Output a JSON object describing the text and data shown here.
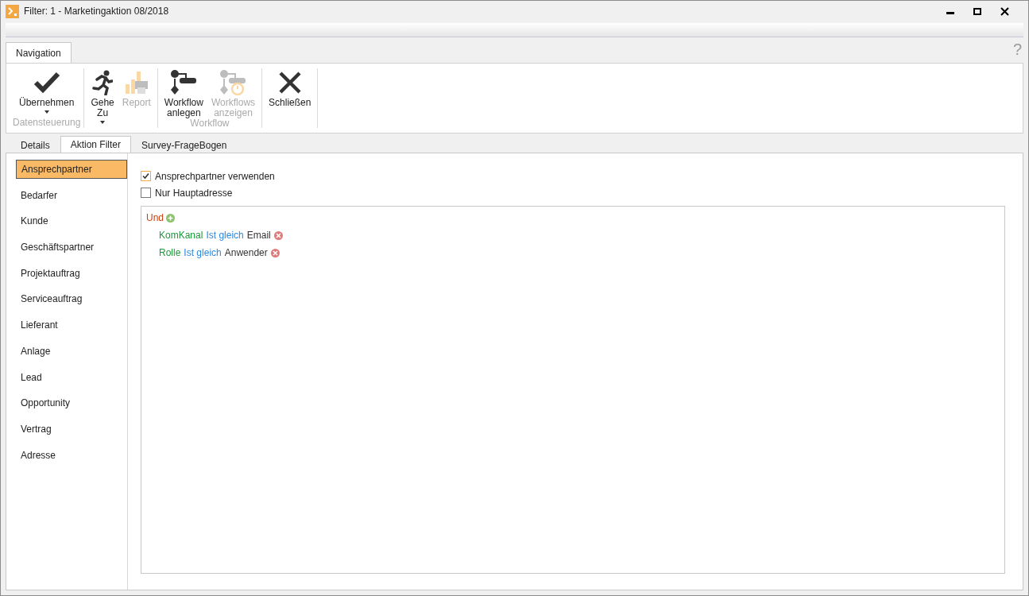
{
  "window": {
    "title": "Filter: 1 - Marketingaktion 08/2018"
  },
  "ribbon": {
    "tabs": [
      {
        "label": "Navigation",
        "selected": true
      }
    ],
    "help": "?",
    "groups": [
      {
        "label": "Datensteuerung",
        "buttons": [
          {
            "kind": "check",
            "label": "Übernehmen",
            "dropdown": true,
            "disabled": false
          }
        ]
      },
      {
        "buttons": [
          {
            "kind": "run",
            "label": "Gehe Zu",
            "dropdown": true,
            "disabled": false
          },
          {
            "kind": "report",
            "label": "Report",
            "dropdown": false,
            "disabled": true
          }
        ]
      },
      {
        "label": "Workflow",
        "buttons": [
          {
            "kind": "flow",
            "label": "Workflow anlegen",
            "dropdown": false,
            "disabled": false
          },
          {
            "kind": "flowtimer",
            "label": "Workflows anzeigen",
            "dropdown": false,
            "disabled": true
          }
        ]
      },
      {
        "buttons": [
          {
            "kind": "close",
            "label": "Schließen",
            "dropdown": false,
            "disabled": false
          }
        ]
      }
    ]
  },
  "doc_tabs": [
    {
      "label": "Details",
      "selected": false
    },
    {
      "label": "Aktion Filter",
      "selected": true
    },
    {
      "label": "Survey-FrageBogen",
      "selected": false
    }
  ],
  "sidebar": {
    "items": [
      {
        "label": "Ansprechpartner",
        "selected": true
      },
      {
        "label": "Bedarfer",
        "selected": false
      },
      {
        "label": "Kunde",
        "selected": false
      },
      {
        "label": "Geschäftspartner",
        "selected": false
      },
      {
        "label": "Projektauftrag",
        "selected": false
      },
      {
        "label": "Serviceauftrag",
        "selected": false
      },
      {
        "label": "Lieferant",
        "selected": false
      },
      {
        "label": "Anlage",
        "selected": false
      },
      {
        "label": "Lead",
        "selected": false
      },
      {
        "label": "Opportunity",
        "selected": false
      },
      {
        "label": "Vertrag",
        "selected": false
      },
      {
        "label": "Adresse",
        "selected": false
      }
    ]
  },
  "options": [
    {
      "label": "Ansprechpartner verwenden",
      "checked": true
    },
    {
      "label": "Nur Hauptadresse",
      "checked": false
    }
  ],
  "filter": {
    "operator": "Und",
    "conditions": [
      {
        "field": "KomKanal",
        "comparison": "Ist gleich",
        "value": "Email"
      },
      {
        "field": "Rolle",
        "comparison": "Ist gleich",
        "value": "Anwender"
      }
    ]
  }
}
